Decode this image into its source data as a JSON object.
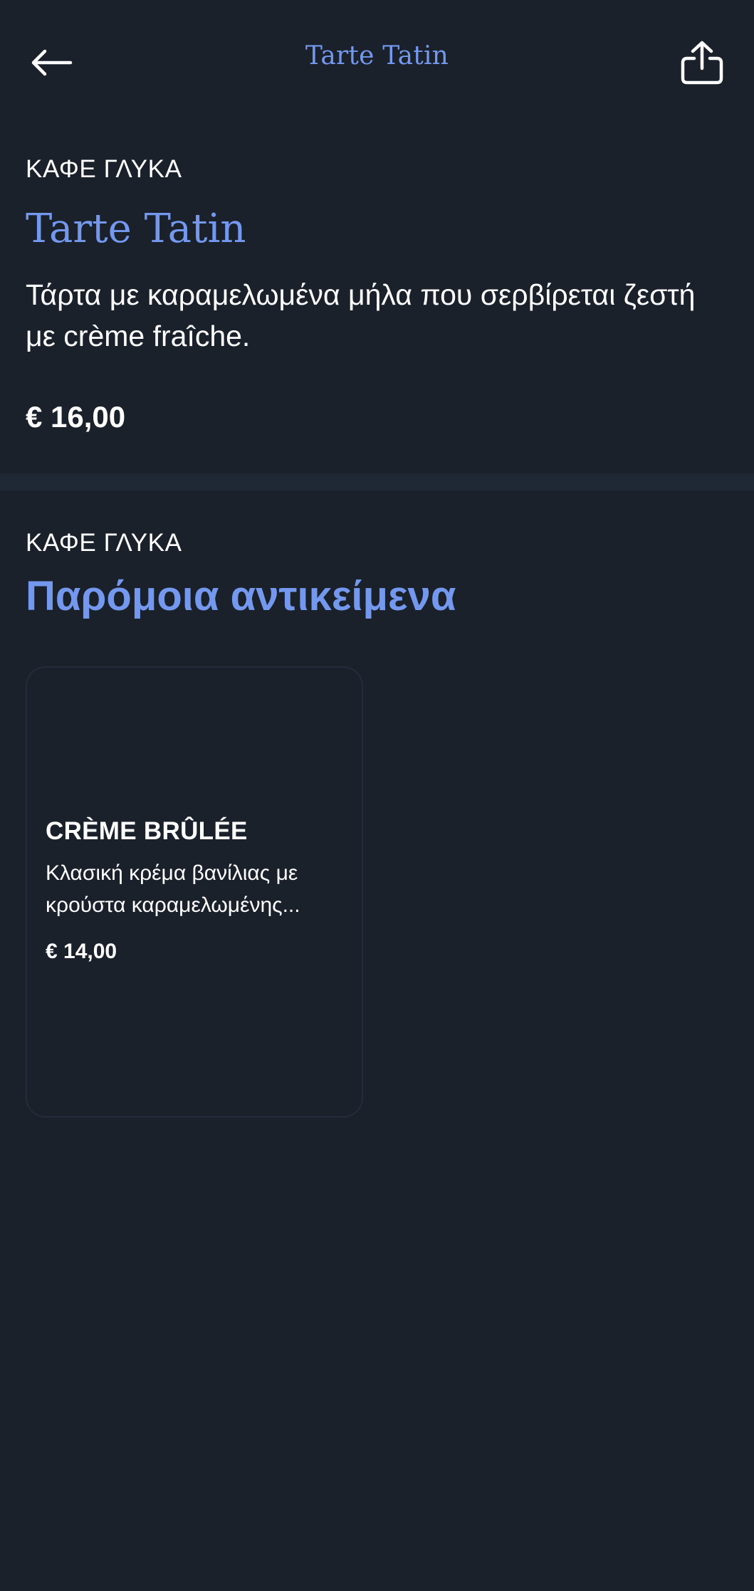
{
  "header": {
    "title": "Tarte Tatin",
    "back_icon": "arrow-left-icon",
    "share_icon": "share-icon"
  },
  "item": {
    "category": "ΚΑΦΕ ΓΛΥΚΑ",
    "title": "Tarte Tatin",
    "description": "Τάρτα με καραμελωμένα μήλα που σερβίρεται ζεστή με crème fraîche.",
    "price": "€ 16,00"
  },
  "similar": {
    "category": "ΚΑΦΕ ΓΛΥΚΑ",
    "title": "Παρόμοια αντικείμενα",
    "items": [
      {
        "name": "CRÈME BRÛLÉE",
        "description": "Κλασική κρέμα βανίλιας με κρούστα καραμελωμένης...",
        "price": "€ 14,00"
      }
    ]
  },
  "colors": {
    "background": "#1b212b",
    "accent": "#7398ee",
    "divider": "#1f2835",
    "text": "#ffffff"
  }
}
